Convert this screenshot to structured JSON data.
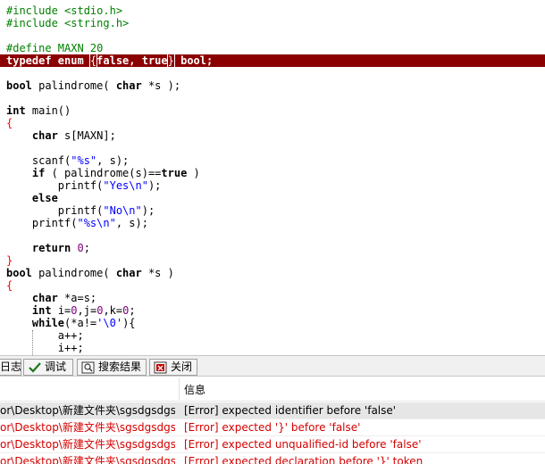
{
  "editor": {
    "lines": [
      [
        {
          "t": "#include <stdio.h>",
          "c": "pre"
        }
      ],
      [
        {
          "t": "#include <string.h>",
          "c": "pre"
        }
      ],
      [],
      [
        {
          "t": "#define MAXN 20",
          "c": "pre"
        }
      ],
      [
        {
          "t": "typedef enum ",
          "c": "kw"
        },
        {
          "t": "{",
          "c": "sym",
          "m": true
        },
        {
          "t": "false, true",
          "c": "kw"
        },
        {
          "t": "}",
          "c": "sym",
          "m": true
        },
        {
          "t": " bool;",
          "c": "kw"
        }
      ],
      [],
      [
        {
          "t": "bool",
          "c": "kw"
        },
        {
          "t": " palindrome( ",
          "c": "txt"
        },
        {
          "t": "char",
          "c": "kw"
        },
        {
          "t": " *s );",
          "c": "txt"
        }
      ],
      [],
      [
        {
          "t": "int",
          "c": "kw"
        },
        {
          "t": " main()",
          "c": "txt"
        }
      ],
      [
        {
          "t": "{",
          "c": "sym"
        }
      ],
      [
        {
          "t": "    ",
          "c": "txt"
        },
        {
          "t": "char",
          "c": "kw"
        },
        {
          "t": " s[MAXN];",
          "c": "txt"
        }
      ],
      [],
      [
        {
          "t": "    scanf(",
          "c": "txt"
        },
        {
          "t": "\"%s\"",
          "c": "str"
        },
        {
          "t": ", s);",
          "c": "txt"
        }
      ],
      [
        {
          "t": "    ",
          "c": "txt"
        },
        {
          "t": "if",
          "c": "kw"
        },
        {
          "t": " ( palindrome(s)==",
          "c": "txt"
        },
        {
          "t": "true",
          "c": "kw"
        },
        {
          "t": " )",
          "c": "txt"
        }
      ],
      [
        {
          "t": "        printf(",
          "c": "txt"
        },
        {
          "t": "\"Yes\\n\"",
          "c": "str"
        },
        {
          "t": ");",
          "c": "txt"
        }
      ],
      [
        {
          "t": "    ",
          "c": "txt"
        },
        {
          "t": "else",
          "c": "kw"
        }
      ],
      [
        {
          "t": "        printf(",
          "c": "txt"
        },
        {
          "t": "\"No\\n\"",
          "c": "str"
        },
        {
          "t": ");",
          "c": "txt"
        }
      ],
      [
        {
          "t": "    printf(",
          "c": "txt"
        },
        {
          "t": "\"%s\\n\"",
          "c": "str"
        },
        {
          "t": ", s);",
          "c": "txt"
        }
      ],
      [],
      [
        {
          "t": "    ",
          "c": "txt"
        },
        {
          "t": "return",
          "c": "kw"
        },
        {
          "t": " ",
          "c": "txt"
        },
        {
          "t": "0",
          "c": "num"
        },
        {
          "t": ";",
          "c": "txt"
        }
      ],
      [
        {
          "t": "}",
          "c": "sym"
        }
      ],
      [
        {
          "t": "bool",
          "c": "kw"
        },
        {
          "t": " palindrome( ",
          "c": "txt"
        },
        {
          "t": "char",
          "c": "kw"
        },
        {
          "t": " *s )",
          "c": "txt"
        }
      ],
      [
        {
          "t": "{",
          "c": "sym"
        }
      ],
      [
        {
          "t": "    ",
          "c": "txt"
        },
        {
          "t": "char",
          "c": "kw"
        },
        {
          "t": " *a=s;",
          "c": "txt"
        }
      ],
      [
        {
          "t": "    ",
          "c": "txt"
        },
        {
          "t": "int",
          "c": "kw"
        },
        {
          "t": " i=",
          "c": "txt"
        },
        {
          "t": "0",
          "c": "num"
        },
        {
          "t": ",j=",
          "c": "txt"
        },
        {
          "t": "0",
          "c": "num"
        },
        {
          "t": ",k=",
          "c": "txt"
        },
        {
          "t": "0",
          "c": "num"
        },
        {
          "t": ";",
          "c": "txt"
        }
      ],
      [
        {
          "t": "    ",
          "c": "txt"
        },
        {
          "t": "while",
          "c": "kw"
        },
        {
          "t": "(*a!=",
          "c": "txt"
        },
        {
          "t": "'\\0'",
          "c": "str"
        },
        {
          "t": "){",
          "c": "txt"
        }
      ],
      [
        {
          "t": "        a++;",
          "c": "txt"
        }
      ],
      [
        {
          "t": "        i++;",
          "c": "txt"
        }
      ]
    ],
    "error_line_index": 4
  },
  "tabs": [
    {
      "label": "日志",
      "icon": "log-icon"
    },
    {
      "label": "调试",
      "icon": "check-icon"
    },
    {
      "label": "搜索结果",
      "icon": "search-icon"
    },
    {
      "label": "关闭",
      "icon": "close-icon"
    }
  ],
  "results": {
    "header": {
      "message": "信息"
    },
    "rows": [
      {
        "file": "or\\Desktop\\新建文件夹\\sgsdgsdgs...",
        "message": "[Error] expected identifier before 'false'",
        "selected": true
      },
      {
        "file": "or\\Desktop\\新建文件夹\\sgsdgsdgs...",
        "message": "[Error] expected '}' before 'false'",
        "selected": false
      },
      {
        "file": "or\\Desktop\\新建文件夹\\sgsdgsdgs...",
        "message": "[Error] expected unqualified-id before 'false'",
        "selected": false
      },
      {
        "file": "or\\Desktop\\新建文件夹\\sgsdgsdgs...",
        "message": "[Error] expected declaration before '}' token",
        "selected": false
      }
    ]
  },
  "colors": {
    "error_line_bg": "#8b0000",
    "error_text": "#d40000",
    "preprocessor": "#008000",
    "string": "#0000ff",
    "number": "#800080",
    "symbol": "#ff0000"
  }
}
